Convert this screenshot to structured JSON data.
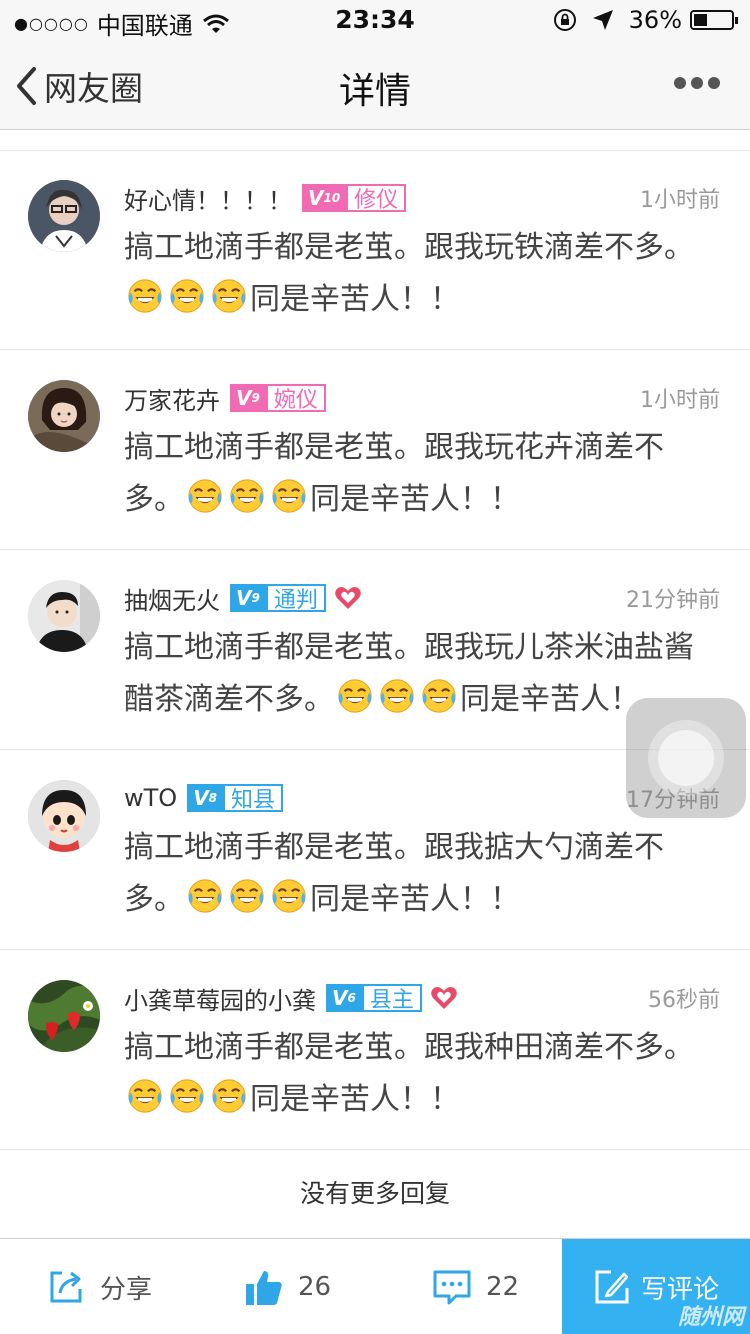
{
  "status_bar": {
    "signal": "●○○○○",
    "carrier": "中国联通",
    "time": "23:34",
    "battery_text": "36%",
    "battery_level": 0.36
  },
  "nav": {
    "back_label": "网友圈",
    "title": "详情"
  },
  "comments": [
    {
      "name": "好心情！！！！",
      "vip_level": "10",
      "vip_title": "修仪",
      "vip_color": "#f06bb3",
      "heart": false,
      "time": "1小时前",
      "text_before": "搞工地滴手都是老茧。跟我玩铁滴差不多。",
      "text_after": "同是辛苦人！！"
    },
    {
      "name": "万家花卉",
      "vip_level": "9",
      "vip_title": "婉仪",
      "vip_color": "#f06bb3",
      "heart": false,
      "time": "1小时前",
      "text_before": "搞工地滴手都是老茧。跟我玩花卉滴差不多。",
      "text_after": "同是辛苦人！！"
    },
    {
      "name": "抽烟无火",
      "vip_level": "9",
      "vip_title": "通判",
      "vip_color": "#2fa6e6",
      "heart": true,
      "time": "21分钟前",
      "text_before": "搞工地滴手都是老茧。跟我玩儿茶米油盐酱醋茶滴差不多。",
      "text_after": "同是辛苦人！"
    },
    {
      "name": "wTO",
      "vip_level": "8",
      "vip_title": "知县",
      "vip_color": "#2fa6e6",
      "heart": false,
      "time": "17分钟前",
      "text_before": "搞工地滴手都是老茧。跟我掂大勺滴差不多。",
      "text_after": "同是辛苦人！！"
    },
    {
      "name": "小龚草莓园的小龚",
      "vip_level": "6",
      "vip_title": "县主",
      "vip_color": "#2fa6e6",
      "heart": true,
      "time": "56秒前",
      "text_before": "搞工地滴手都是老茧。跟我种田滴差不多。",
      "text_after": "同是辛苦人！！"
    }
  ],
  "no_more_label": "没有更多回复",
  "bottom_bar": {
    "share_label": "分享",
    "like_count": "26",
    "comment_count": "22",
    "write_label": "写评论",
    "watermark": "随州网"
  },
  "colors": {
    "accent": "#33b1f0",
    "icon_blue": "#2fa6e6",
    "heart": "#e84a6a",
    "emoji_face": "#ffcc33"
  }
}
